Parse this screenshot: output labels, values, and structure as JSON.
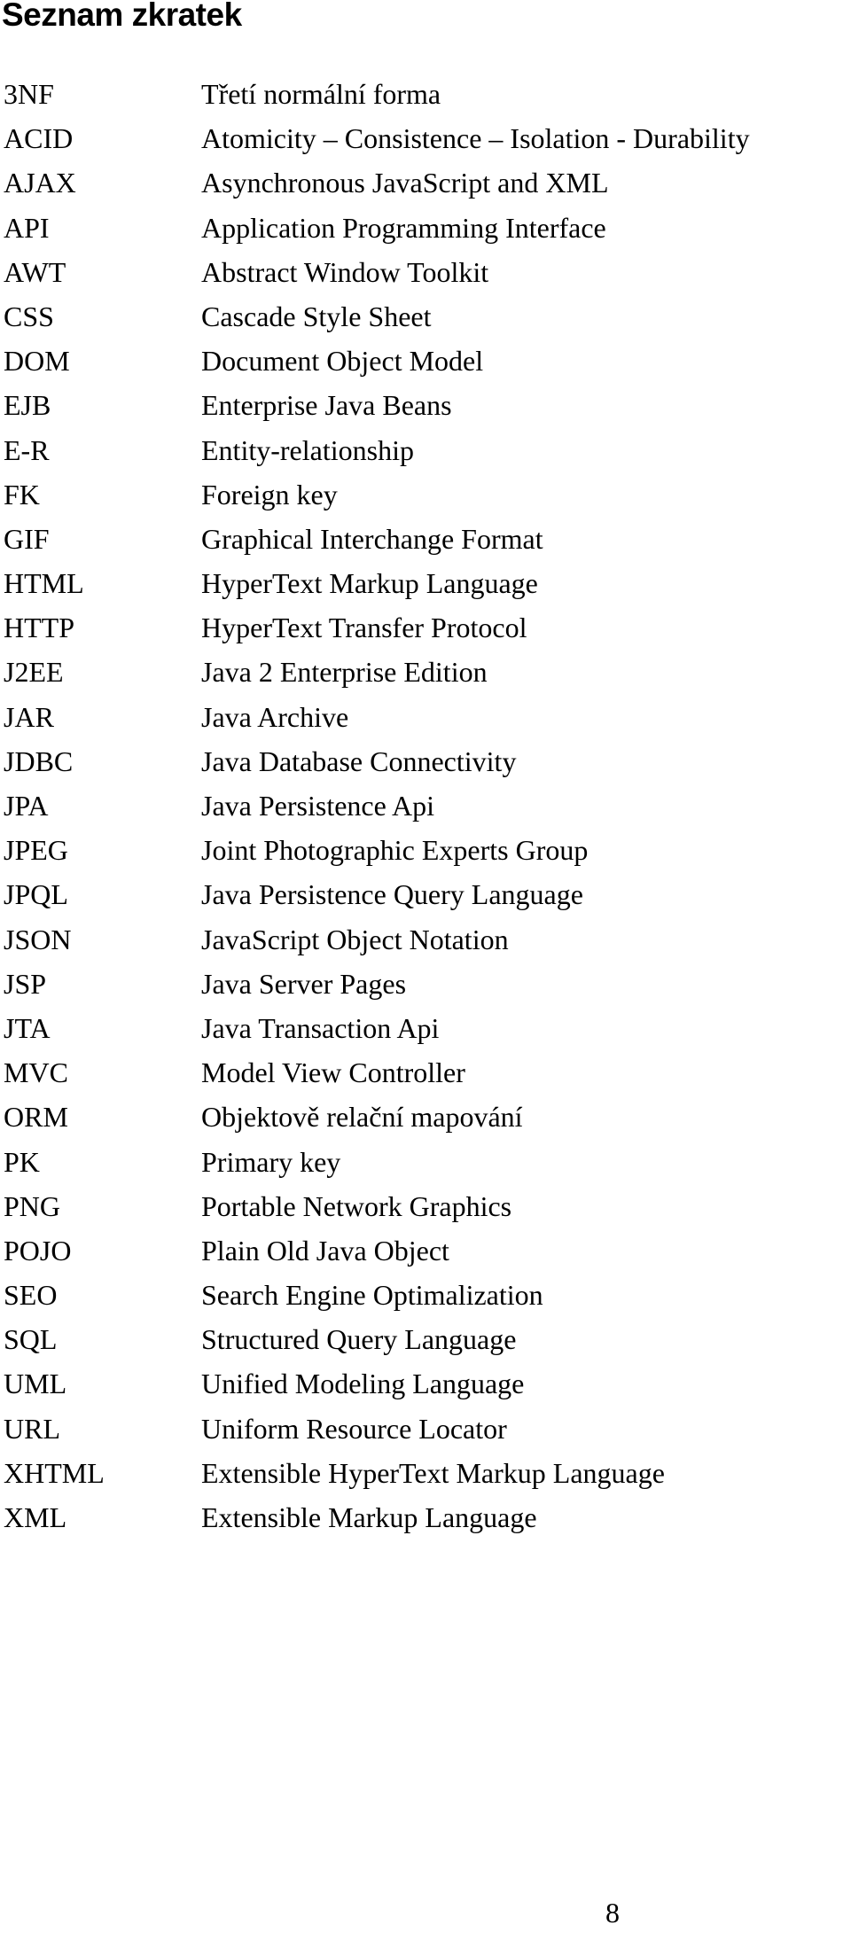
{
  "title": "Seznam zkratek",
  "abbreviations": [
    {
      "abbr": "3NF",
      "definition": "Třetí normální forma"
    },
    {
      "abbr": "ACID",
      "definition": "Atomicity – Consistence – Isolation - Durability"
    },
    {
      "abbr": "AJAX",
      "definition": "Asynchronous JavaScript and XML"
    },
    {
      "abbr": "API",
      "definition": "Application Programming Interface"
    },
    {
      "abbr": "AWT",
      "definition": "Abstract Window Toolkit"
    },
    {
      "abbr": "CSS",
      "definition": "Cascade Style Sheet"
    },
    {
      "abbr": "DOM",
      "definition": "Document Object Model"
    },
    {
      "abbr": "EJB",
      "definition": "Enterprise Java Beans"
    },
    {
      "abbr": "E-R",
      "definition": "Entity-relationship"
    },
    {
      "abbr": "FK",
      "definition": "Foreign key"
    },
    {
      "abbr": "GIF",
      "definition": "Graphical Interchange Format"
    },
    {
      "abbr": "HTML",
      "definition": "HyperText Markup Language"
    },
    {
      "abbr": "HTTP",
      "definition": "HyperText Transfer Protocol"
    },
    {
      "abbr": "J2EE",
      "definition": "Java 2 Enterprise Edition"
    },
    {
      "abbr": "JAR",
      "definition": "Java Archive"
    },
    {
      "abbr": "JDBC",
      "definition": "Java Database Connectivity"
    },
    {
      "abbr": "JPA",
      "definition": "Java Persistence Api"
    },
    {
      "abbr": "JPEG",
      "definition": "Joint Photographic Experts Group"
    },
    {
      "abbr": "JPQL",
      "definition": "Java Persistence Query Language"
    },
    {
      "abbr": "JSON",
      "definition": "JavaScript Object Notation"
    },
    {
      "abbr": "JSP",
      "definition": "Java Server Pages"
    },
    {
      "abbr": "JTA",
      "definition": "Java Transaction Api"
    },
    {
      "abbr": "MVC",
      "definition": "Model View Controller"
    },
    {
      "abbr": "ORM",
      "definition": "Objektově relační mapování"
    },
    {
      "abbr": "PK",
      "definition": "Primary key"
    },
    {
      "abbr": "PNG",
      "definition": "Portable Network Graphics"
    },
    {
      "abbr": "POJO",
      "definition": "Plain Old Java Object"
    },
    {
      "abbr": "SEO",
      "definition": "Search Engine Optimalization"
    },
    {
      "abbr": "SQL",
      "definition": "Structured Query Language"
    },
    {
      "abbr": "UML",
      "definition": "Unified Modeling Language"
    },
    {
      "abbr": "URL",
      "definition": "Uniform Resource Locator"
    },
    {
      "abbr": "XHTML",
      "definition": "Extensible HyperText Markup Language"
    },
    {
      "abbr": "XML",
      "definition": "Extensible Markup Language"
    }
  ],
  "page_number": "8"
}
